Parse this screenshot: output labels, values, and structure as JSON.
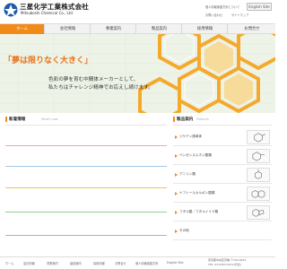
{
  "header": {
    "company_name": "三星化学工業株式会社",
    "company_name_en": "Mitsuboshi Chemical Co., Ltd",
    "util_links": [
      "お問い合わせ",
      "個人情報保護方針について",
      "サイトマップ"
    ],
    "english_label": "English Site"
  },
  "nav": {
    "items": [
      "ホーム",
      "会社情報",
      "事業案内",
      "製品案内",
      "採用情報",
      "お問合せ"
    ],
    "active_index": 0
  },
  "hero": {
    "title": "「夢は限りなく大きく」",
    "line1": "色彩の夢を育む中間体メーカーとして、",
    "line2": "私たちはチャレンジ精神でお応えし続けます。"
  },
  "news": {
    "title": "新着情報",
    "title_en": "What's new",
    "row_colors": [
      "#f0a0c0",
      "#a0c8e8",
      "#f0c060",
      "#90d090",
      "#c0a0e0"
    ]
  },
  "products": {
    "title": "製品案内",
    "title_en": "Products",
    "items": [
      {
        "label": "ジケテン誘導体"
      },
      {
        "label": "ベンゼンスルホン酸類"
      },
      {
        "label": "アニリン類"
      },
      {
        "label": "ナフトールカルボン酸類"
      },
      {
        "label": "フタル酸／フタルイミド類"
      },
      {
        "label": "その他"
      }
    ],
    "accent": "#f28a18"
  },
  "footer": {
    "links": [
      "ホーム",
      "会社情報",
      "事業案内",
      "製品案内",
      "採用情報",
      "お問合せ",
      "個人情報保護方針",
      "English Site"
    ],
    "address": "東京都中央区京橋 〒104-0031",
    "tel": "TEL: 03-5203-5211(代表)"
  }
}
